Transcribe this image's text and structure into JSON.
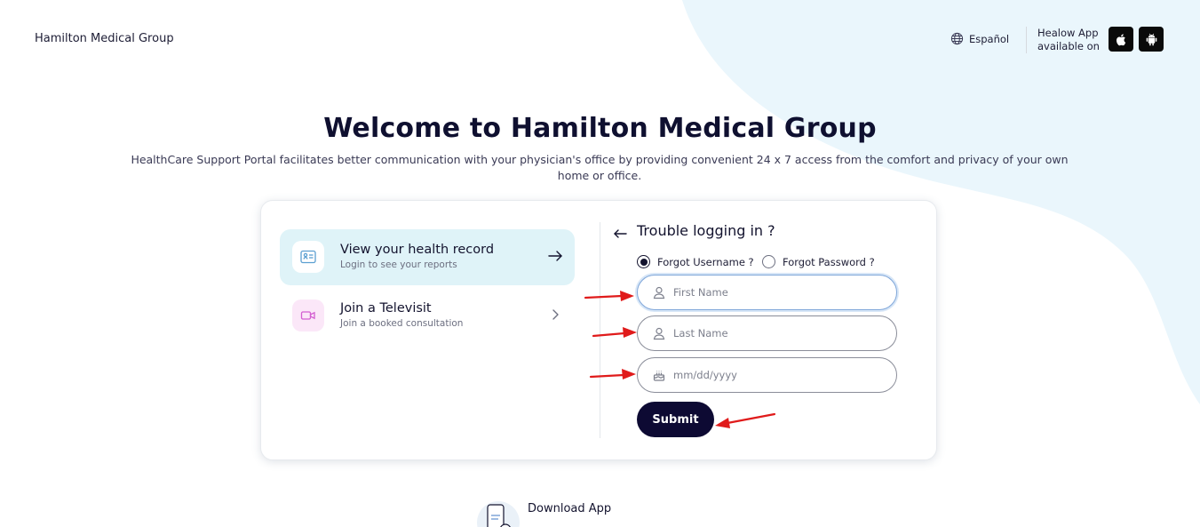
{
  "header": {
    "org_name": "Hamilton Medical Group",
    "language_label": "Español",
    "app_text_line1": "Healow App",
    "app_text_line2": "available on",
    "apple_icon": "apple-icon",
    "android_icon": "android-icon"
  },
  "hero": {
    "title": "Welcome to Hamilton Medical Group",
    "subtitle": "HealthCare Support Portal facilitates better communication with your physician's office by providing convenient 24 x 7 access from the comfort and privacy of your own home or office."
  },
  "options": [
    {
      "title": "View your health record",
      "subtitle": "Login to see your reports",
      "icon": "health-record-icon",
      "active": true
    },
    {
      "title": "Join a Televisit",
      "subtitle": "Join a booked consultation",
      "icon": "video-icon",
      "active": false
    }
  ],
  "recovery": {
    "heading": "Trouble logging in ?",
    "radio_username": "Forgot Username ?",
    "radio_password": "Forgot Password ?",
    "selected": "username",
    "first_name_placeholder": "First Name",
    "last_name_placeholder": "Last Name",
    "dob_placeholder": "mm/dd/yyyy",
    "submit_label": "Submit"
  },
  "download": {
    "title": "Download App"
  },
  "colors": {
    "primary_dark": "#0d0a33",
    "accent_bg": "#dff3f8",
    "page_blob": "#eaf6fc",
    "annotation_red": "#e01b1b"
  }
}
